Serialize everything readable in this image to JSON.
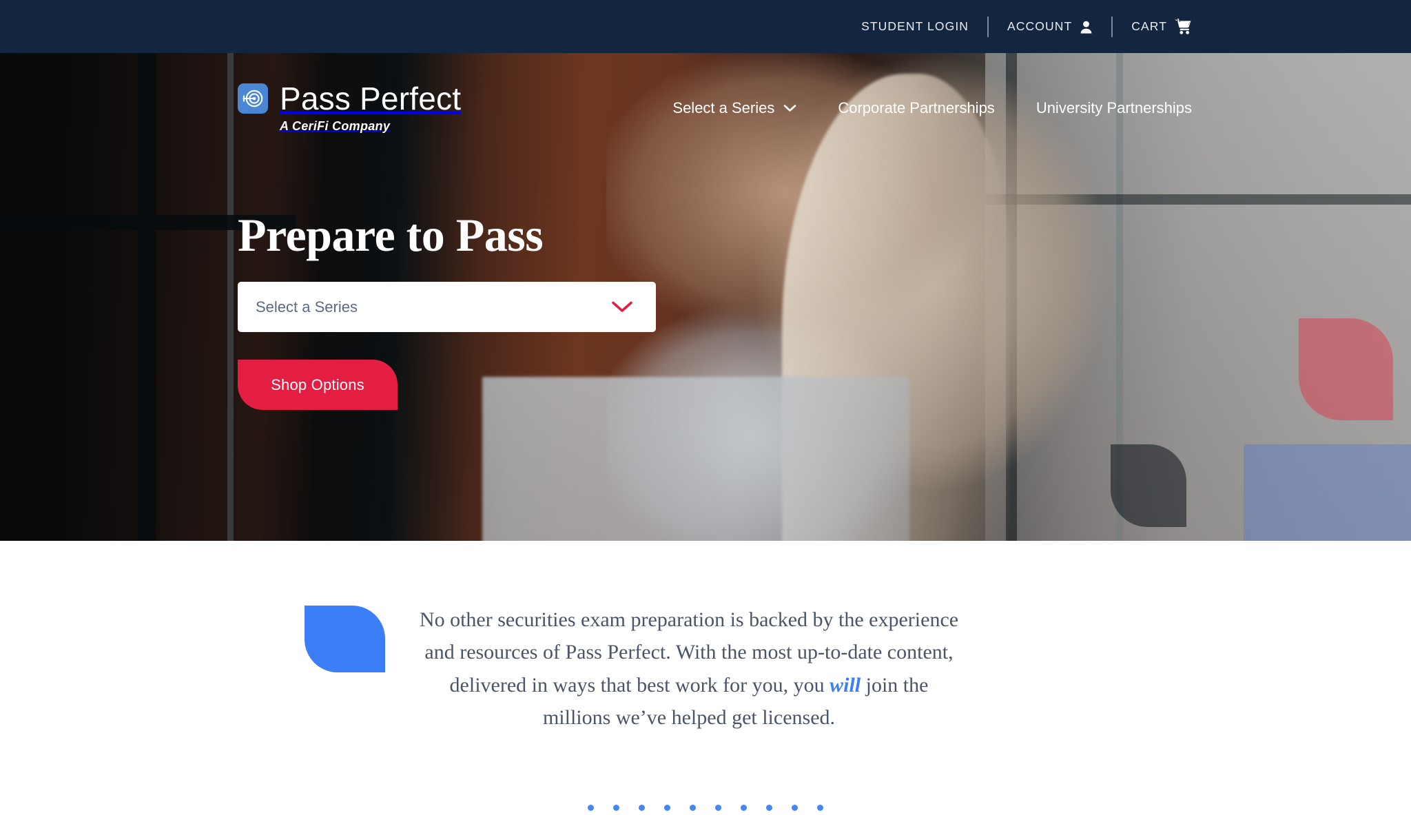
{
  "topbar": {
    "student_login": "STUDENT LOGIN",
    "account": "ACCOUNT",
    "cart": "CART",
    "account_icon": "user-icon",
    "cart_icon": "shopping-cart-icon"
  },
  "brand": {
    "name": "Pass Perfect",
    "tagline": "A CeriFi Company",
    "mark_icon": "target-arrow-icon"
  },
  "nav": {
    "items": [
      {
        "label": "Select a Series",
        "has_caret": true,
        "caret_icon": "chevron-down-icon"
      },
      {
        "label": "Corporate Partnerships",
        "has_caret": false
      },
      {
        "label": "University Partnerships",
        "has_caret": false
      }
    ]
  },
  "hero": {
    "title": "Prepare to Pass",
    "select": {
      "placeholder": "Select a Series",
      "value": "Select a Series",
      "caret_icon": "chevron-down-icon",
      "caret_color": "#e31e42"
    },
    "cta": {
      "label": "Shop Options",
      "color": "#e31e42"
    },
    "decor": {
      "leaf_red": "#d64658",
      "leaf_dark": "#0c121a",
      "panel_blue": "#5478cd"
    }
  },
  "intro": {
    "leaf_color": "#3b7ef5",
    "paragraph_part1": "No other securities exam preparation is backed by the experience and resources of Pass Perfect. With the most up-to-date content, delivered in ways that best work for you, you ",
    "paragraph_emphasis": "will",
    "paragraph_part2": " join the millions we’ve helped get licensed."
  },
  "carousel": {
    "dot_count": 10,
    "dot_color": "#4786f0",
    "active_index": 0
  },
  "colors": {
    "navy": "#13253f",
    "red": "#e31e42",
    "blue": "#3b7ef5",
    "brand_blue": "#4a86d4"
  }
}
